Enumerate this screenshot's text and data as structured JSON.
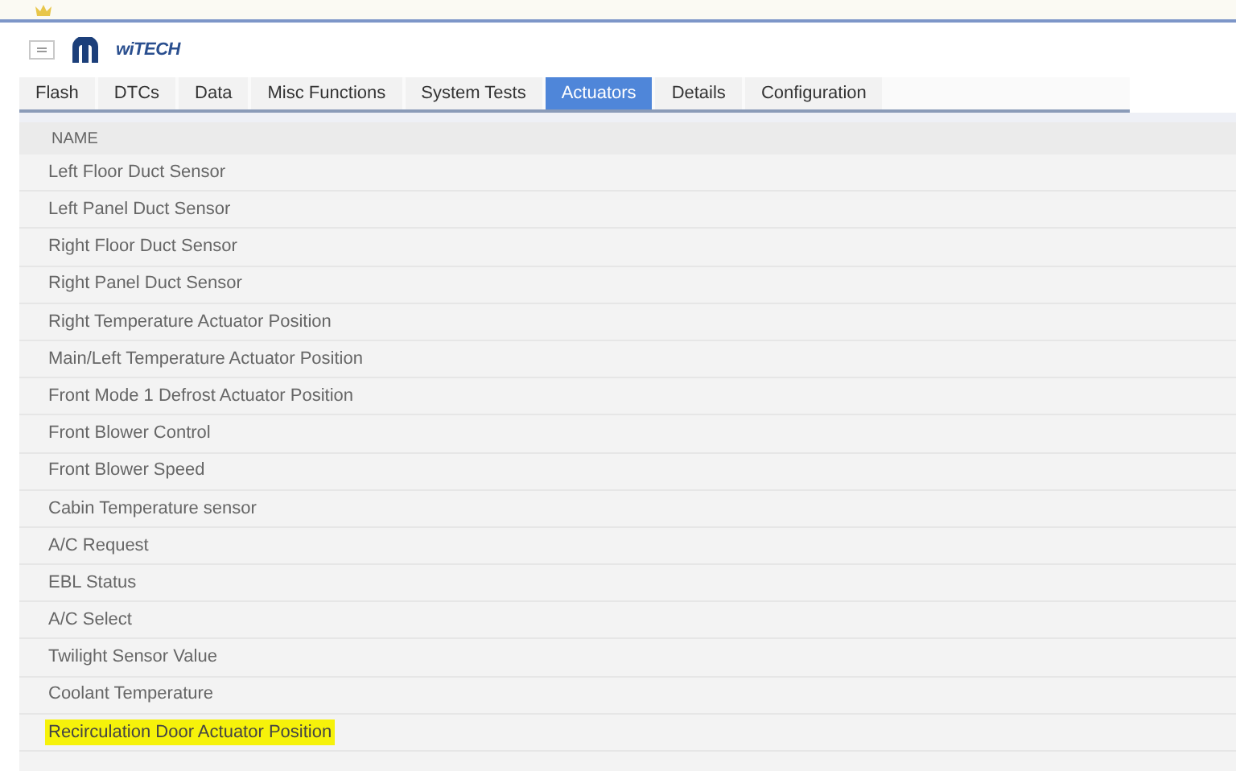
{
  "header": {
    "logo_text": "wiTECH"
  },
  "tabs": [
    {
      "label": "Flash",
      "selected": false
    },
    {
      "label": "DTCs",
      "selected": false
    },
    {
      "label": "Data",
      "selected": false
    },
    {
      "label": "Misc Functions",
      "selected": false
    },
    {
      "label": "System Tests",
      "selected": false
    },
    {
      "label": "Actuators",
      "selected": true
    },
    {
      "label": "Details",
      "selected": false
    },
    {
      "label": "Configuration",
      "selected": false
    }
  ],
  "table": {
    "columns": [
      "NAME"
    ],
    "rows": [
      {
        "name": "Left Floor Duct Sensor",
        "highlighted": false
      },
      {
        "name": "Left Panel Duct Sensor",
        "highlighted": false
      },
      {
        "name": "Right Floor Duct Sensor",
        "highlighted": false
      },
      {
        "name": "Right Panel Duct Sensor",
        "highlighted": false
      },
      {
        "name": "Right Temperature Actuator Position",
        "highlighted": false
      },
      {
        "name": "Main/Left Temperature Actuator Position",
        "highlighted": false
      },
      {
        "name": "Front Mode 1 Defrost Actuator Position",
        "highlighted": false
      },
      {
        "name": "Front Blower Control",
        "highlighted": false
      },
      {
        "name": "Front Blower Speed",
        "highlighted": false
      },
      {
        "name": "Cabin Temperature sensor",
        "highlighted": false
      },
      {
        "name": "A/C Request",
        "highlighted": false
      },
      {
        "name": "EBL Status",
        "highlighted": false
      },
      {
        "name": "A/C Select",
        "highlighted": false
      },
      {
        "name": "Twilight Sensor Value",
        "highlighted": false
      },
      {
        "name": "Coolant Temperature",
        "highlighted": false
      },
      {
        "name": "Recirculation Door Actuator Position",
        "highlighted": true
      }
    ]
  }
}
